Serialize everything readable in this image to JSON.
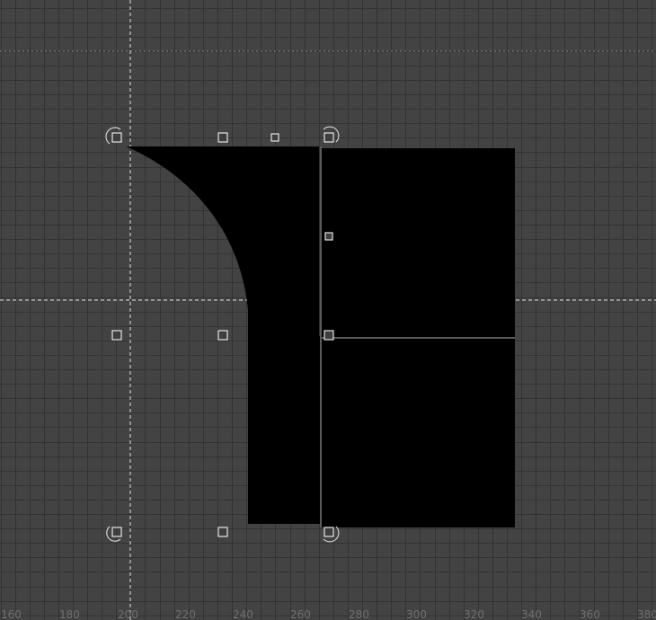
{
  "colors": {
    "canvas_bg": "#434343",
    "grid": "#333333",
    "shape_fill": "#000000",
    "guide": "#e8e8e8",
    "ruler_text": "#6f6f6f"
  },
  "ruler": {
    "x_labels": [
      "160",
      "180",
      "200",
      "220",
      "240",
      "260",
      "280",
      "300",
      "320",
      "340",
      "360",
      "380"
    ]
  },
  "selection": {
    "rotate_handles": [
      "rotate-handle-top-left",
      "rotate-handle-top-right",
      "rotate-handle-bottom-left",
      "rotate-handle-bottom-right"
    ]
  }
}
